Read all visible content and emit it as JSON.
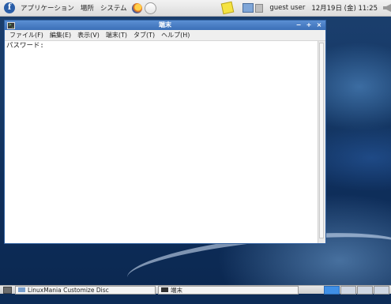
{
  "top_panel": {
    "applications_label": "アプリケーション",
    "places_label": "場所",
    "system_label": "システム",
    "user_label": "guest user",
    "clock_text": "12月19日 (金) 11:25"
  },
  "window": {
    "title": "端末",
    "title_icon_glyph": ">_",
    "minimize_glyph": "−",
    "maximize_glyph": "+",
    "close_glyph": "×",
    "menu": [
      "ファイル(F)",
      "編集(E)",
      "表示(V)",
      "端末(T)",
      "タブ(T)",
      "ヘルプ(H)"
    ],
    "terminal_text": "パスワード:"
  },
  "bottom_panel": {
    "tasks": [
      {
        "label": "LinuxMania Customize Disc"
      },
      {
        "label": "端末"
      }
    ],
    "workspaces": 4,
    "active_workspace": 1
  },
  "colors": {
    "titlebar": "#4a7fc6",
    "desktop": "#163966",
    "active_workspace": "#3f8fe6"
  },
  "icons": [
    "fedora-logo-icon",
    "firefox-icon",
    "mail-icon",
    "notes-icon",
    "network-icon",
    "volume-icon",
    "speaker-icon",
    "show-desktop-icon",
    "folder-icon",
    "terminal-icon"
  ]
}
